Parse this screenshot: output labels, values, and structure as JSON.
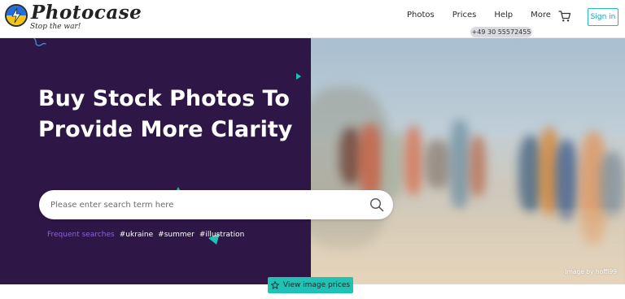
{
  "brand": {
    "name": "Photocase",
    "tagline": "Stop the war!"
  },
  "nav": {
    "items": [
      "Photos",
      "Prices",
      "Help",
      "More"
    ],
    "signin_label": "Sign in",
    "phone": "+49 30 55572455"
  },
  "hero": {
    "headline": "Buy Stock Photos To Provide More Clarity",
    "search_placeholder": "Please enter search term here",
    "frequent_label": "Frequent searches",
    "frequent_tags": [
      "#ukraine",
      "#summer",
      "#illustration"
    ],
    "image_credit": "Image by hoffi99"
  },
  "cta": {
    "prices_label": "View image prices"
  },
  "colors": {
    "hero_bg": "#2e1646",
    "accent_teal": "#1fc2b4",
    "signin_border": "#26b6c4",
    "frequent_label": "#8e62d3"
  },
  "icons": [
    "lightning-icon",
    "cart-icon",
    "search-icon",
    "star-icon"
  ]
}
